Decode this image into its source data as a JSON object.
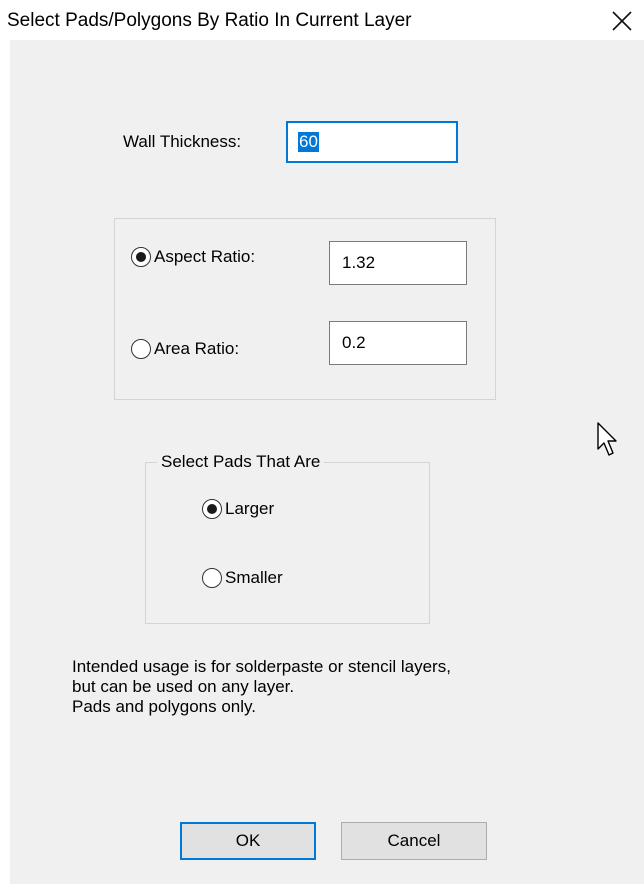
{
  "window": {
    "title": "Select Pads/Polygons By Ratio In Current Layer",
    "close_icon": "close-icon"
  },
  "wall_thickness": {
    "label": "Wall Thickness:",
    "value": "60"
  },
  "ratio_group": {
    "aspect_label": "Aspect Ratio:",
    "aspect_value": "1.32",
    "aspect_checked": true,
    "area_label": "Area Ratio:",
    "area_value": "0.2",
    "area_checked": false
  },
  "select_group": {
    "title": "Select Pads That Are",
    "larger_label": "Larger",
    "larger_checked": true,
    "smaller_label": "Smaller",
    "smaller_checked": false
  },
  "note": {
    "line1": "Intended usage is for solderpaste or stencil layers,",
    "line2": "but can be used on any layer.",
    "line3": "Pads and polygons only."
  },
  "buttons": {
    "ok": "OK",
    "cancel": "Cancel"
  },
  "cursor_icon": "mouse-pointer-icon"
}
